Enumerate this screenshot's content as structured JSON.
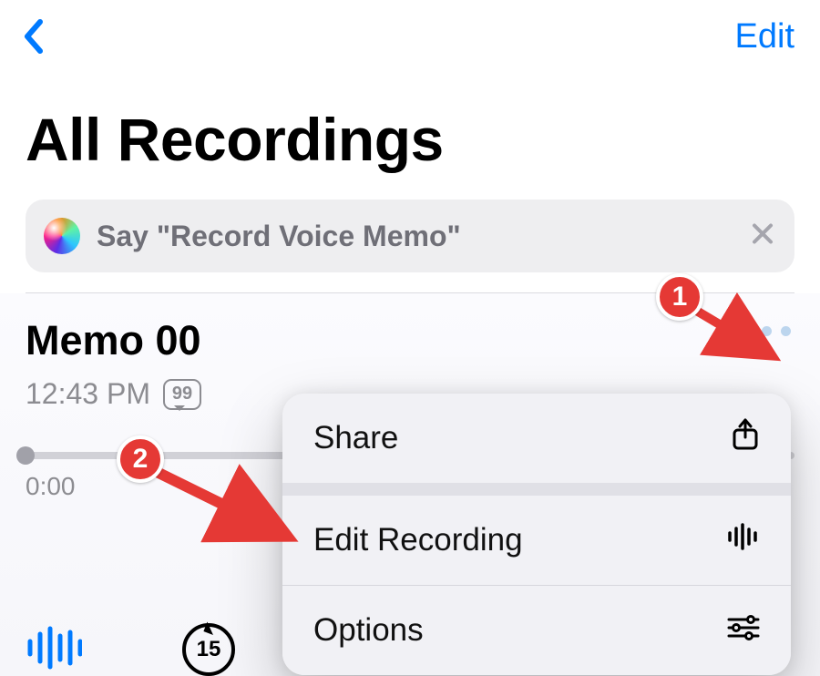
{
  "nav": {
    "edit_label": "Edit"
  },
  "page_title": "All Recordings",
  "siri": {
    "hint": "Say \"Record Voice Memo\""
  },
  "memo": {
    "title": "Memo 00",
    "time": "12:43 PM",
    "transcript_glyph": "99",
    "scrub_time": "0:00",
    "skip_back_label": "15"
  },
  "menu": {
    "share": "Share",
    "edit_recording": "Edit Recording",
    "options": "Options"
  },
  "annotations": {
    "step1": "1",
    "step2": "2"
  },
  "colors": {
    "accent": "#007AFF",
    "callout": "#E53935"
  }
}
